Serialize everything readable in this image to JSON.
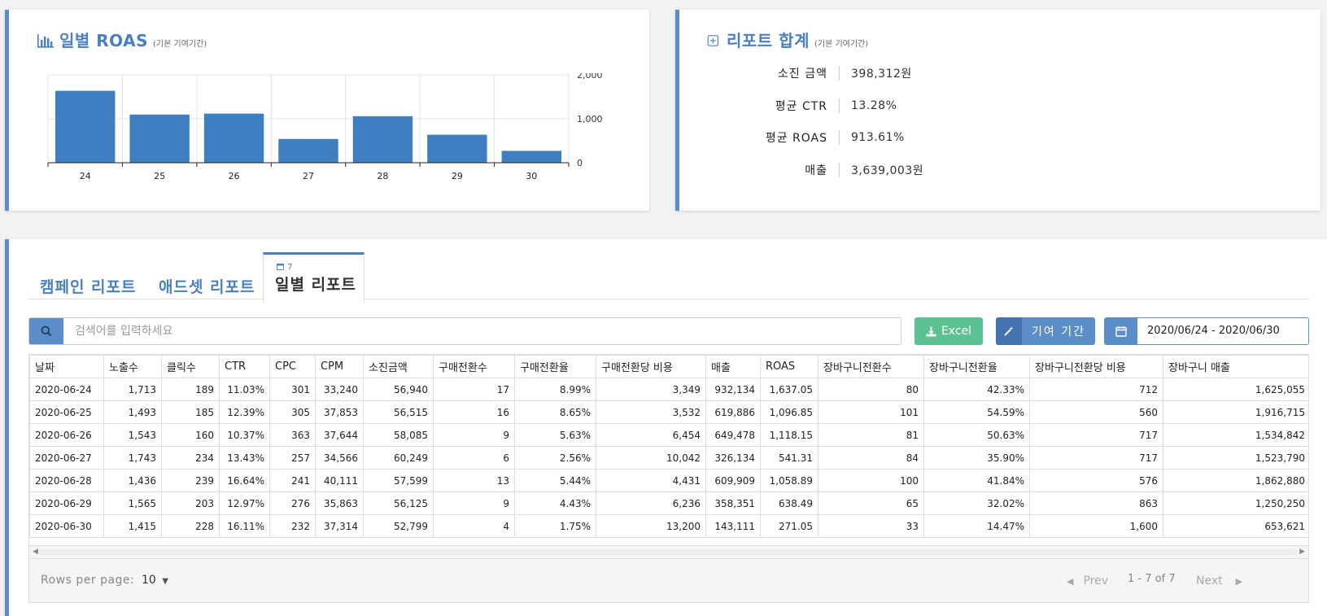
{
  "roas_card": {
    "title": "일별 ROAS",
    "subtitle": "(기본 기여기간)",
    "icon": "bar-chart-icon"
  },
  "chart_data": {
    "type": "bar",
    "categories": [
      "24",
      "25",
      "26",
      "27",
      "28",
      "29",
      "30"
    ],
    "values": [
      1637.05,
      1096.85,
      1118.15,
      541.31,
      1058.89,
      638.49,
      271.05
    ],
    "y_tick_labels": [
      "2,000",
      "1,000",
      "0"
    ],
    "ylim": [
      0,
      2000
    ],
    "y_axis_position": "right",
    "grid": true,
    "bar_color": "#3f7fc1"
  },
  "summary_card": {
    "title": "리포트 합계",
    "subtitle": "(기본 기여기간)",
    "icon": "plus-square-icon",
    "rows": [
      {
        "label": "소진 금액",
        "value": "398,312원"
      },
      {
        "label": "평균 CTR",
        "value": "13.28%"
      },
      {
        "label": "평균 ROAS",
        "value": "913.61%"
      },
      {
        "label": "매출",
        "value": "3,639,003원"
      }
    ]
  },
  "tabs": [
    {
      "label": "캠페인 리포트",
      "active": false
    },
    {
      "label": "애드셋 리포트",
      "active": false
    },
    {
      "label": "일별 리포트",
      "active": true,
      "badge": "7",
      "badge_icon": "calendar-icon"
    }
  ],
  "toolbar": {
    "search_placeholder": "검색어를 입력하세요",
    "excel_label": "Excel",
    "period_label": "기여 기간",
    "date_range": "2020/06/24 - 2020/06/30"
  },
  "table": {
    "headers": [
      "날짜",
      "노출수",
      "클릭수",
      "CTR",
      "CPC",
      "CPM",
      "소진금액",
      "구매전환수",
      "구매전환율",
      "구매전환당 비용",
      "매출",
      "ROAS",
      "장바구니전환수",
      "장바구니전환율",
      "장바구니전환당 비용",
      "장바구니 매출"
    ],
    "rows": [
      [
        "2020-06-24",
        "1,713",
        "189",
        "11.03%",
        "301",
        "33,240",
        "56,940",
        "17",
        "8.99%",
        "3,349",
        "932,134",
        "1,637.05",
        "80",
        "42.33%",
        "712",
        "1,625,055"
      ],
      [
        "2020-06-25",
        "1,493",
        "185",
        "12.39%",
        "305",
        "37,853",
        "56,515",
        "16",
        "8.65%",
        "3,532",
        "619,886",
        "1,096.85",
        "101",
        "54.59%",
        "560",
        "1,916,715"
      ],
      [
        "2020-06-26",
        "1,543",
        "160",
        "10.37%",
        "363",
        "37,644",
        "58,085",
        "9",
        "5.63%",
        "6,454",
        "649,478",
        "1,118.15",
        "81",
        "50.63%",
        "717",
        "1,534,842"
      ],
      [
        "2020-06-27",
        "1,743",
        "234",
        "13.43%",
        "257",
        "34,566",
        "60,249",
        "6",
        "2.56%",
        "10,042",
        "326,134",
        "541.31",
        "84",
        "35.90%",
        "717",
        "1,523,790"
      ],
      [
        "2020-06-28",
        "1,436",
        "239",
        "16.64%",
        "241",
        "40,111",
        "57,599",
        "13",
        "5.44%",
        "4,431",
        "609,909",
        "1,058.89",
        "100",
        "41.84%",
        "576",
        "1,862,880"
      ],
      [
        "2020-06-29",
        "1,565",
        "203",
        "12.97%",
        "276",
        "35,863",
        "56,125",
        "9",
        "4.43%",
        "6,236",
        "358,351",
        "638.49",
        "65",
        "32.02%",
        "863",
        "1,250,250"
      ],
      [
        "2020-06-30",
        "1,415",
        "228",
        "16.11%",
        "232",
        "37,314",
        "52,799",
        "4",
        "1.75%",
        "13,200",
        "143,111",
        "271.05",
        "33",
        "14.47%",
        "1,600",
        "653,621"
      ]
    ]
  },
  "pagination": {
    "rows_per_page_label": "Rows per page:",
    "rows_per_page_value": "10",
    "prev_label": "Prev",
    "info": "1 - 7 of 7",
    "next_label": "Next"
  }
}
